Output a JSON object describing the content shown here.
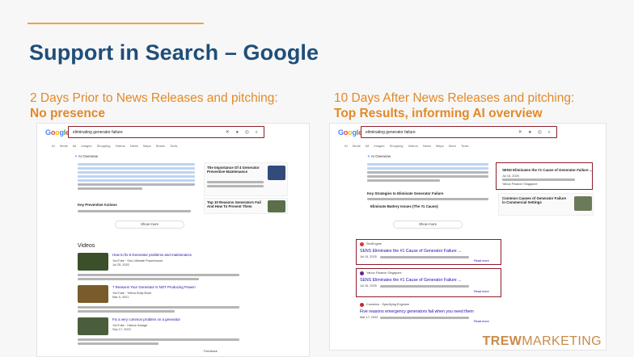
{
  "title": "Support in Search – Google",
  "left": {
    "heading": "2 Days Prior to News Releases and pitching:",
    "subheading": "No presence",
    "query": "eliminating generator failure",
    "tabs": "AI Mode All Images Shopping Videos News Maps Books Tools",
    "ai_overview": "AI Overview",
    "key_actions": "Key Preventive Actions",
    "show_more": "Show more",
    "side_card_1": "The Importance Of 4 Generator Preventive Maintenance",
    "side_card_2": "Top 10 Reasons Generators Fail And How To Prevent Them",
    "videos_heading": "Videos",
    "videos": [
      {
        "title": "How to fix 8 Generator problems and maintenance",
        "channel": "YouTube · Sun Ultimate Powerhouse",
        "date": "Jul 25, 2020"
      },
      {
        "title": "7 Reasons Your Generator is NOT Producing Power!",
        "channel": "YouTube · Yellow Bully Build",
        "date": "Mar 5, 2021"
      },
      {
        "title": "Fix a very common problem on a generator",
        "channel": "YouTube · Hanna Garage",
        "date": "Sep 17, 2023"
      }
    ],
    "footer": "Feedback"
  },
  "right": {
    "heading": "10 Days After News Releases and pitching:",
    "subheading": "Top Results, informing AI overview",
    "query": "eliminating generator failure",
    "tabs": "AI Mode All Images Shopping Videos News Maps More Tools",
    "ai_overview": "AI Overview",
    "key_strategies": "Key Strategies to Eliminate Generator Failure",
    "bullet": "Eliminate Battery Issues (The #1 Cause):",
    "show_more": "Show more",
    "side_card_1": "SENS Eliminates the #1 Cause of Generator Failure ...",
    "side_card_1_date": "Jul 15, 2025",
    "side_card_1_source": "Yahoo Finance Singapore",
    "side_card_2": "Common Causes of Generator Failure in Commercial Settings",
    "results": [
      {
        "site": "StorEngine",
        "title": "SENS Eliminates the #1 Cause of Generator Failure ...",
        "date": "Jul 15, 2025",
        "more": "Read more"
      },
      {
        "site": "Yahoo Finance Singapore",
        "title": "SENS Eliminates the #1 Cause of Generator Failure ...",
        "date": "Jul 15, 2025",
        "more": "Read more"
      },
      {
        "site": "Cummins · Specifying Engineer",
        "title": "Five reasons emergency generators fail when you need them",
        "date": "Mar 17, 2022",
        "more": "Read more"
      }
    ]
  },
  "brand": {
    "part1": "TREW",
    "part2": "MARKETING"
  },
  "colors": {
    "title": "#1f4e79",
    "accent": "#e28a27",
    "box": "#8b1e2a",
    "brand": "#c98a4a"
  }
}
